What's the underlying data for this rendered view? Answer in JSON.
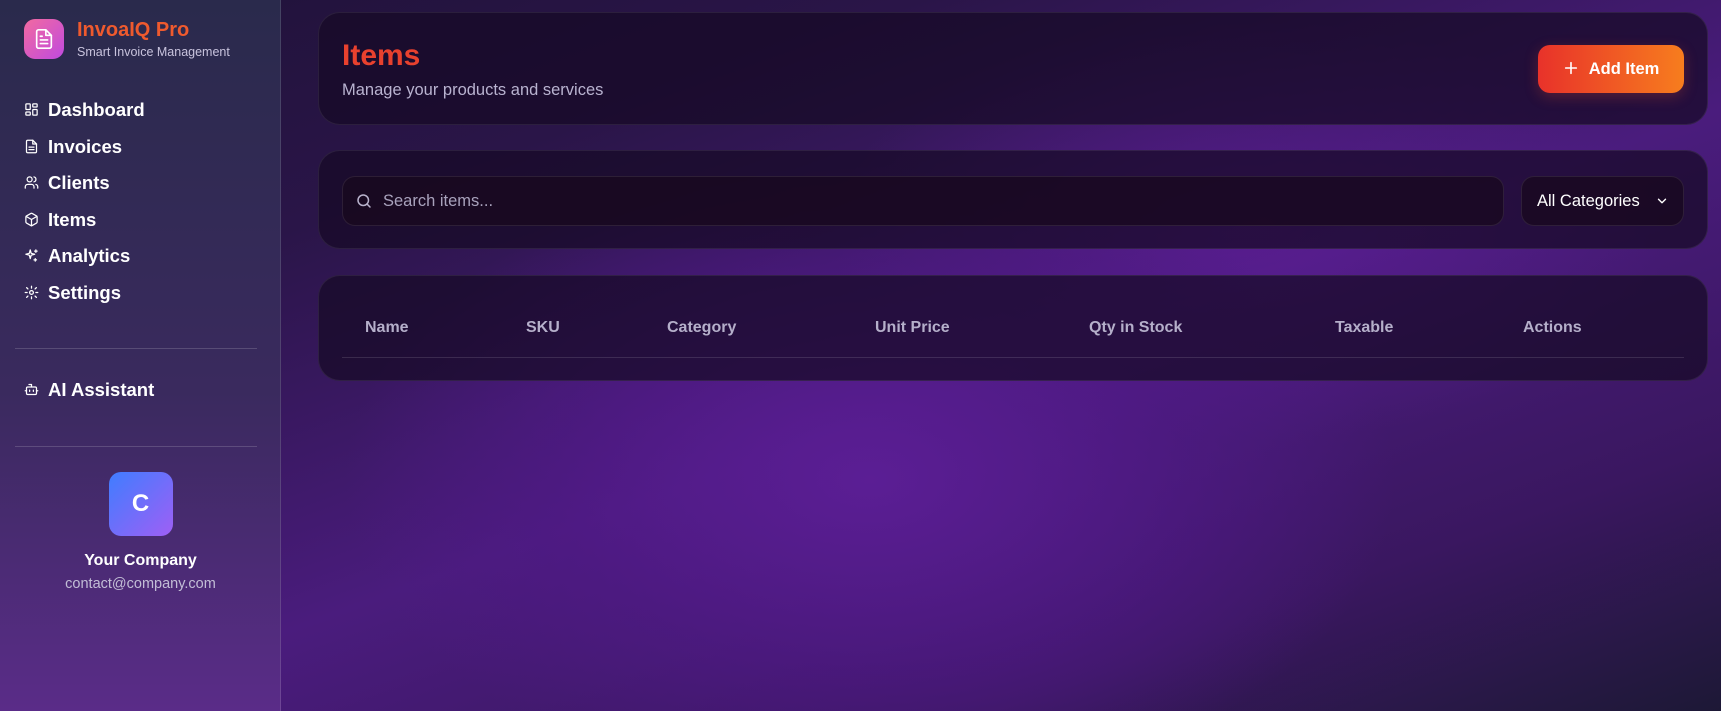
{
  "brand": {
    "name": "InvoaIQ Pro",
    "tagline": "Smart Invoice Management"
  },
  "sidebar": {
    "items": [
      {
        "label": "Dashboard",
        "icon": "grid-icon"
      },
      {
        "label": "Invoices",
        "icon": "document-icon"
      },
      {
        "label": "Clients",
        "icon": "users-icon"
      },
      {
        "label": "Items",
        "icon": "package-icon"
      },
      {
        "label": "Analytics",
        "icon": "sparkles-icon"
      },
      {
        "label": "Settings",
        "icon": "gear-icon"
      }
    ],
    "assistant": {
      "label": "AI Assistant",
      "icon": "bot-icon"
    }
  },
  "company": {
    "initial": "C",
    "name": "Your Company",
    "email": "contact@company.com"
  },
  "header": {
    "title": "Items",
    "subtitle": "Manage your products and services",
    "add_button": "Add Item"
  },
  "filters": {
    "search_placeholder": "Search items...",
    "category_selected": "All Categories"
  },
  "table": {
    "columns": [
      "Name",
      "SKU",
      "Category",
      "Unit Price",
      "Qty in Stock",
      "Taxable",
      "Actions"
    ]
  },
  "colors": {
    "accent": "#e8412e",
    "brand": "#ef5a2e",
    "button_gradient_start": "#e8322a",
    "button_gradient_end": "#f77d1e",
    "avatar_gradient_start": "#3f7dff",
    "avatar_gradient_end": "#9f5ff5"
  }
}
